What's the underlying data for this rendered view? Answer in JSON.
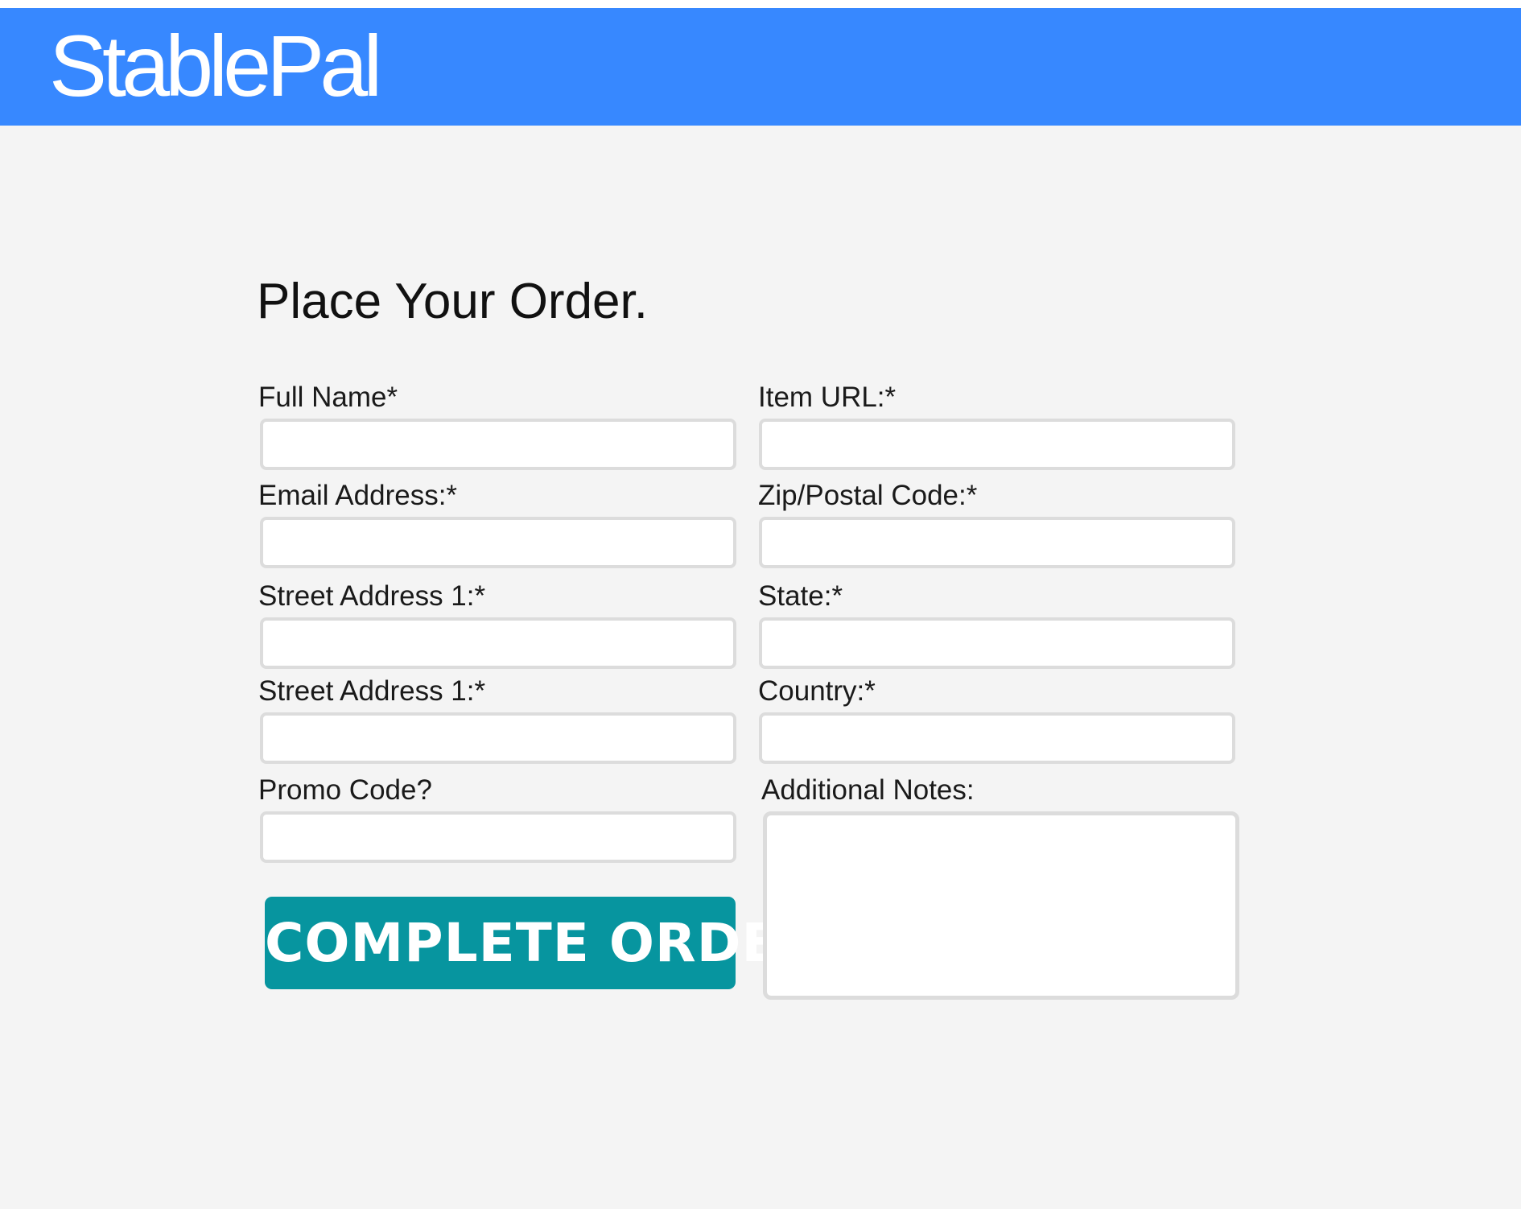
{
  "header": {
    "brand": "StablePal",
    "background_color": "#3788ff"
  },
  "form": {
    "title": "Place Your Order.",
    "fields": {
      "full_name": {
        "label": "Full Name*",
        "value": ""
      },
      "email": {
        "label": "Email Address:*",
        "value": ""
      },
      "street_address_1": {
        "label": "Street Address 1:*",
        "value": ""
      },
      "street_address_2": {
        "label": "Street Address 1:*",
        "value": ""
      },
      "promo_code": {
        "label": "Promo Code?",
        "value": ""
      },
      "item_url": {
        "label": "Item URL:*",
        "value": ""
      },
      "zip": {
        "label": "Zip/Postal Code:*",
        "value": ""
      },
      "state": {
        "label": "State:*",
        "value": ""
      },
      "country": {
        "label": "Country:*",
        "value": ""
      },
      "notes": {
        "label": "Additional Notes:",
        "value": ""
      }
    },
    "submit_label": "COMPLETE ORDER",
    "submit_color": "#07959f"
  }
}
